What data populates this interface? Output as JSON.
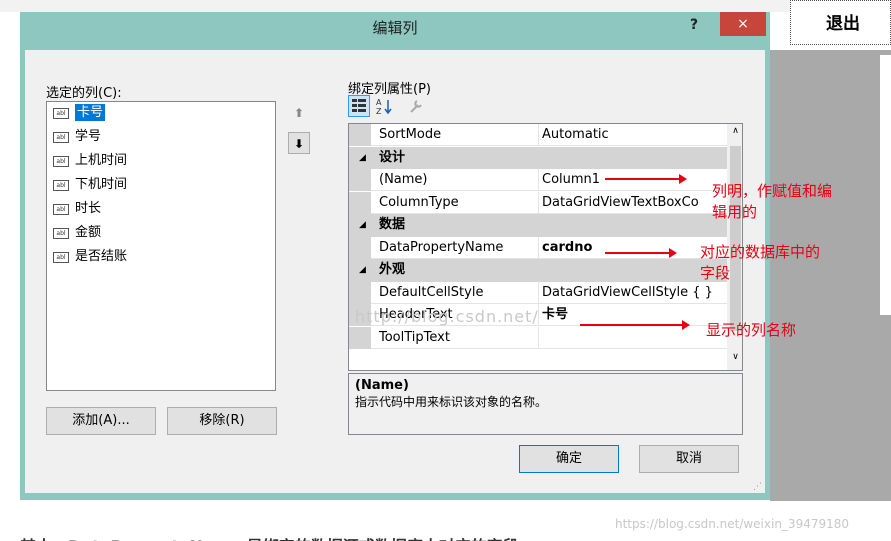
{
  "background": {
    "exit_label": "退出"
  },
  "dialog": {
    "title": "编辑列",
    "help_label": "?",
    "close_label": "×",
    "selected_columns_label": "选定的列(C):",
    "columns": [
      {
        "label": "卡号",
        "icon": "abl-icon"
      },
      {
        "label": "学号",
        "icon": "abl-icon"
      },
      {
        "label": "上机时间",
        "icon": "abl-icon"
      },
      {
        "label": "下机时间",
        "icon": "abl-icon"
      },
      {
        "label": "时长",
        "icon": "abl-icon"
      },
      {
        "label": "金额",
        "icon": "abl-icon"
      },
      {
        "label": "是否结账",
        "icon": "abl-icon"
      }
    ],
    "bound_props_label": "绑定列属性(P)",
    "properties": {
      "row0": {
        "name": "SortMode",
        "value": "Automatic"
      },
      "cat_design": "设计",
      "row1": {
        "name": "(Name)",
        "value": "Column1"
      },
      "row2": {
        "name": "ColumnType",
        "value": "DataGridViewTextBoxCo"
      },
      "cat_data": "数据",
      "row3": {
        "name": "DataPropertyName",
        "value": "cardno"
      },
      "cat_appearance": "外观",
      "row4": {
        "name": "DefaultCellStyle",
        "value": "DataGridViewCellStyle { }"
      },
      "row5": {
        "name": "HeaderText",
        "value": "卡号"
      },
      "row6": {
        "name": "ToolTipText",
        "value": ""
      }
    },
    "description": {
      "title": "(Name)",
      "text": "指示代码中用来标识该对象的名称。"
    },
    "buttons": {
      "add": "添加(A)...",
      "remove": "移除(R)",
      "ok": "确定",
      "cancel": "取消"
    }
  },
  "annotations": {
    "name_note_1": "列明，作赋值和编",
    "name_note_2": "辑用的",
    "data_note_1": "对应的数据库中的",
    "data_note_2": "字段",
    "header_note": "显示的列名称"
  },
  "watermark": "https://blog.csdn.net/weixin_39479180",
  "ghost_watermark": "http://blog.csdn.net/",
  "caption": "其中：DataPropertyName 是绑定的数据源或数据库中对应的字段",
  "colors": {
    "annotation": "#e60012",
    "frame": "#8ec6c0",
    "selection": "#0078d7"
  }
}
